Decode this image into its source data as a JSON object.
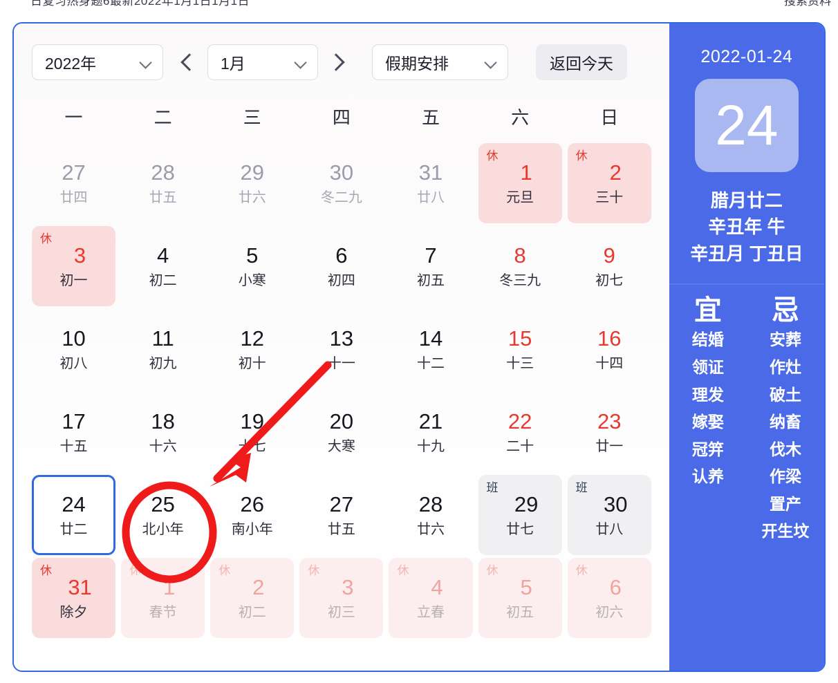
{
  "page": {
    "cropped_top_text": "日复习热身题6最新2022年1月1日1月1日",
    "cropped_top_right_text": "搜索资料"
  },
  "toolbar": {
    "year_value": "2022年",
    "month_value": "1月",
    "holiday_value": "假期安排",
    "today_label": "返回今天",
    "prev_icon": "chevron-left-icon",
    "next_icon": "chevron-right-icon",
    "dropdown_icon": "chevron-down-icon"
  },
  "weekdays": [
    "一",
    "二",
    "三",
    "四",
    "五",
    "六",
    "日"
  ],
  "days": [
    {
      "num": "27",
      "sub": "廿四",
      "type": "outside"
    },
    {
      "num": "28",
      "sub": "廿五",
      "type": "outside"
    },
    {
      "num": "29",
      "sub": "廿六",
      "type": "outside"
    },
    {
      "num": "30",
      "sub": "冬二九",
      "type": "outside"
    },
    {
      "num": "31",
      "sub": "廿八",
      "type": "outside"
    },
    {
      "num": "1",
      "sub": "元旦",
      "type": "holiday",
      "badge": "休"
    },
    {
      "num": "2",
      "sub": "三十",
      "type": "holiday",
      "badge": "休"
    },
    {
      "num": "3",
      "sub": "初一",
      "type": "holiday",
      "badge": "休"
    },
    {
      "num": "4",
      "sub": "初二",
      "type": "normal"
    },
    {
      "num": "5",
      "sub": "小寒",
      "type": "normal"
    },
    {
      "num": "6",
      "sub": "初四",
      "type": "normal"
    },
    {
      "num": "7",
      "sub": "初五",
      "type": "normal"
    },
    {
      "num": "8",
      "sub": "冬三九",
      "type": "weekend"
    },
    {
      "num": "9",
      "sub": "初七",
      "type": "weekend"
    },
    {
      "num": "10",
      "sub": "初八",
      "type": "normal"
    },
    {
      "num": "11",
      "sub": "初九",
      "type": "normal"
    },
    {
      "num": "12",
      "sub": "初十",
      "type": "normal"
    },
    {
      "num": "13",
      "sub": "十一",
      "type": "normal"
    },
    {
      "num": "14",
      "sub": "十二",
      "type": "normal"
    },
    {
      "num": "15",
      "sub": "十三",
      "type": "weekend"
    },
    {
      "num": "16",
      "sub": "十四",
      "type": "weekend"
    },
    {
      "num": "17",
      "sub": "十五",
      "type": "normal"
    },
    {
      "num": "18",
      "sub": "十六",
      "type": "normal"
    },
    {
      "num": "19",
      "sub": "十七",
      "type": "normal"
    },
    {
      "num": "20",
      "sub": "大寒",
      "type": "normal"
    },
    {
      "num": "21",
      "sub": "十九",
      "type": "normal"
    },
    {
      "num": "22",
      "sub": "二十",
      "type": "weekend"
    },
    {
      "num": "23",
      "sub": "廿一",
      "type": "weekend"
    },
    {
      "num": "24",
      "sub": "廿二",
      "type": "today"
    },
    {
      "num": "25",
      "sub": "北小年",
      "type": "normal"
    },
    {
      "num": "26",
      "sub": "南小年",
      "type": "normal"
    },
    {
      "num": "27",
      "sub": "廿五",
      "type": "normal"
    },
    {
      "num": "28",
      "sub": "廿六",
      "type": "normal"
    },
    {
      "num": "29",
      "sub": "廿七",
      "type": "workday",
      "badge": "班"
    },
    {
      "num": "30",
      "sub": "廿八",
      "type": "workday",
      "badge": "班"
    },
    {
      "num": "31",
      "sub": "除夕",
      "type": "holiday",
      "badge": "休"
    },
    {
      "num": "1",
      "sub": "春节",
      "type": "next-holiday",
      "badge": "休"
    },
    {
      "num": "2",
      "sub": "初二",
      "type": "next-holiday",
      "badge": "休"
    },
    {
      "num": "3",
      "sub": "初三",
      "type": "next-holiday",
      "badge": "休"
    },
    {
      "num": "4",
      "sub": "立春",
      "type": "next-holiday",
      "badge": "休"
    },
    {
      "num": "5",
      "sub": "初五",
      "type": "next-holiday",
      "badge": "休"
    },
    {
      "num": "6",
      "sub": "初六",
      "type": "next-holiday",
      "badge": "休"
    }
  ],
  "sidebar": {
    "date": "2022-01-24",
    "big_day": "24",
    "lunar_date": "腊月廿二",
    "lunar_year": "辛丑年 牛",
    "lunar_month_day": "辛丑月 丁丑日",
    "yi_head": "宜",
    "ji_head": "忌",
    "yi_items": [
      "结婚",
      "领证",
      "理发",
      "嫁娶",
      "冠笄",
      "认养"
    ],
    "ji_items": [
      "安葬",
      "作灶",
      "破土",
      "纳畜",
      "伐木",
      "作梁",
      "置产",
      "开生坟"
    ]
  },
  "annotation": {
    "circled_day": "25",
    "color": "#ef1b1b"
  },
  "colors": {
    "brand_blue": "#4a6ae8",
    "today_border": "#2f6ae4",
    "holiday_bg": "#fbdcdc",
    "holiday_red": "#e8392e",
    "workday_bg": "#f0f0f3",
    "annotation_red": "#ef1b1b"
  }
}
